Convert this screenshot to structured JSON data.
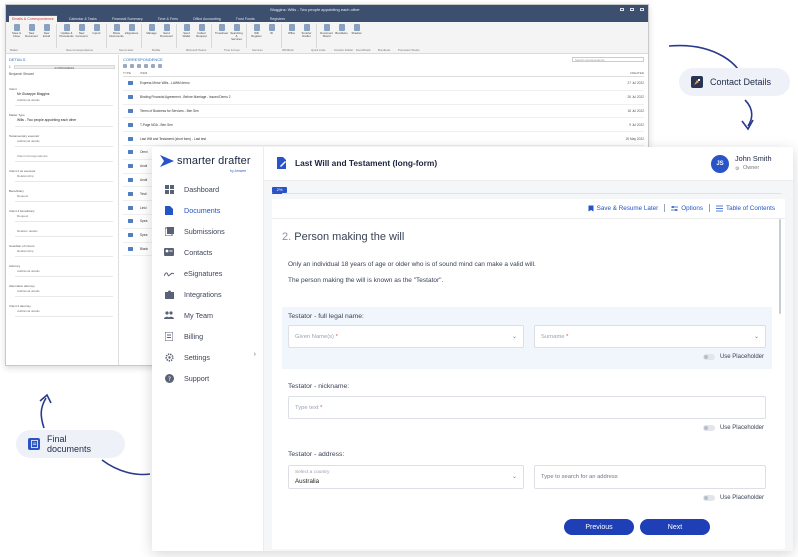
{
  "background_app": {
    "title": "Bloggins: Wills - Two people appointing each other",
    "tabs": [
      "Emails & Correspondence",
      "Calendar & Tasks",
      "Financial Summary",
      "Time & Fees",
      "Office Accounting",
      "Trust Funds",
      "Registers"
    ],
    "ribbon_buttons": [
      "Save & Close",
      "New Document",
      "New Email",
      "Update & Precedents",
      "New Comment",
      "Import",
      "Share Documents",
      "eSignature",
      "Manage",
      "Send Document",
      "Send Wallet",
      "Collect Request",
      "Timesheet",
      "Searching & Services",
      "Will Register",
      "ID",
      "Office",
      "Smarter Drafter",
      "Document Shield",
      "BundleHo",
      "Shadow"
    ],
    "ribbon_groups": [
      "Matter",
      "New Correspondence",
      "Send Letter",
      "Mobile",
      "Microsoft Teams",
      "Time & Fees",
      "Services",
      "Will Bank",
      "Quick Links",
      "Smarter Drafter",
      "DocuShield",
      "BundleHo",
      "Precedent Studio"
    ],
    "details": {
      "heading": "DETAILS",
      "number": "1",
      "number_state": "IN PROGRESS",
      "client_line": "Benjamin Stewart",
      "fields": [
        {
          "label": "Client",
          "value": "Mr Giuseppe Bloggins",
          "sub": "Additional details"
        },
        {
          "label": "Matter Type",
          "value": "Wills - Two people appointing each other",
          "sub": ""
        },
        {
          "label": "Testamentary executor",
          "value": "",
          "sub": "Additional details"
        },
        {
          "label": "",
          "value": "",
          "sub": "Client Correspondence"
        },
        {
          "label": "Client 2 as executor",
          "value": "",
          "sub": "Relationship"
        },
        {
          "label": "Beneficiary",
          "value": "",
          "sub": "Request"
        },
        {
          "label": "Client 2 beneficiary",
          "value": "",
          "sub": "Request"
        },
        {
          "label": "",
          "value": "",
          "sub": "Relation details"
        },
        {
          "label": "Guardian of minors",
          "value": "",
          "sub": "Relationship"
        },
        {
          "label": "Attorney",
          "value": "",
          "sub": "Additional details"
        },
        {
          "label": "Alternative attorney",
          "value": "",
          "sub": "Additional details"
        },
        {
          "label": "Client 2 attorney",
          "value": "",
          "sub": "Additional details"
        }
      ]
    },
    "correspondence": {
      "heading": "CORRESPONDENCE",
      "search_placeholder": "Search correspondence",
      "col_type": "TYPE",
      "col_item": "ITEM",
      "col_created": "CREATED",
      "rows": [
        {
          "title": "Express Mirror Wills - LAWM demo",
          "date": "27 Jul 2022"
        },
        {
          "title": "Binding Financial Agreement - Before Marriage - Issued Demo 2",
          "date": "26 Jul 2022"
        },
        {
          "title": "Terms of Business for Services - Ben Sen",
          "date": "18 Jul 2022"
        },
        {
          "title": "T-Page NDA - Ben Sen",
          "date": "9 Jul 2022"
        },
        {
          "title": "Last Will and Testament (short form) - Last test",
          "date": "20 May 2022"
        },
        {
          "title": "Omni",
          "date": ""
        },
        {
          "title": "Anotl",
          "date": ""
        },
        {
          "title": "Anotl",
          "date": ""
        },
        {
          "title": "Testi",
          "date": ""
        },
        {
          "title": "Linki",
          "date": ""
        },
        {
          "title": "Spea",
          "date": ""
        },
        {
          "title": "Spea",
          "date": ""
        },
        {
          "title": "Blank",
          "date": ""
        }
      ]
    }
  },
  "callouts": {
    "contact_details": "Contact Details",
    "final_documents": "Final documents"
  },
  "sidebar": {
    "brand": "smarter drafter",
    "brand_sub": "by Amwee",
    "items": [
      {
        "label": "Dashboard",
        "icon": "dashboard-icon"
      },
      {
        "label": "Documents",
        "icon": "document-icon",
        "active": true
      },
      {
        "label": "Submissions",
        "icon": "submissions-icon"
      },
      {
        "label": "Contacts",
        "icon": "contacts-icon"
      },
      {
        "label": "eSignatures",
        "icon": "signature-icon"
      },
      {
        "label": "Integrations",
        "icon": "puzzle-icon"
      },
      {
        "label": "My Team",
        "icon": "team-icon"
      },
      {
        "label": "Billing",
        "icon": "billing-icon"
      },
      {
        "label": "Settings",
        "icon": "gear-icon"
      },
      {
        "label": "Support",
        "icon": "help-icon"
      }
    ]
  },
  "header": {
    "doc_title": "Last Will and Testament (long-form)",
    "user_initials": "JS",
    "user_name": "John Smith",
    "user_role": "Owner"
  },
  "progress": {
    "label": "2%",
    "value": 0.02
  },
  "toolbar": {
    "save_label": "Save & Resume Later",
    "options_label": "Options",
    "toc_label": "Table of Contents"
  },
  "section": {
    "number": "2.",
    "title": "Person making the will",
    "intro_1": "Only an individual 18 years of age or older who is of sound mind can make a valid will.",
    "intro_2": "The person making the will is known as the \"Testator\"."
  },
  "questions": {
    "name_label": "Testator - full legal name:",
    "given_placeholder": "Given Name(s)",
    "surname_placeholder": "Surname",
    "use_placeholder": "Use Placeholder",
    "nickname_label": "Testator - nickname:",
    "nickname_placeholder": "Type text",
    "address_label": "Testator - address:",
    "country_label": "Select a country",
    "country_value": "Australia",
    "address_placeholder": "Type to search for an address"
  },
  "buttons": {
    "previous": "Previous",
    "next": "Next"
  },
  "colors": {
    "brand_blue": "#2953c6",
    "button_blue": "#1e3fb6",
    "navy": "#1b2440",
    "required": "#d9534f"
  }
}
